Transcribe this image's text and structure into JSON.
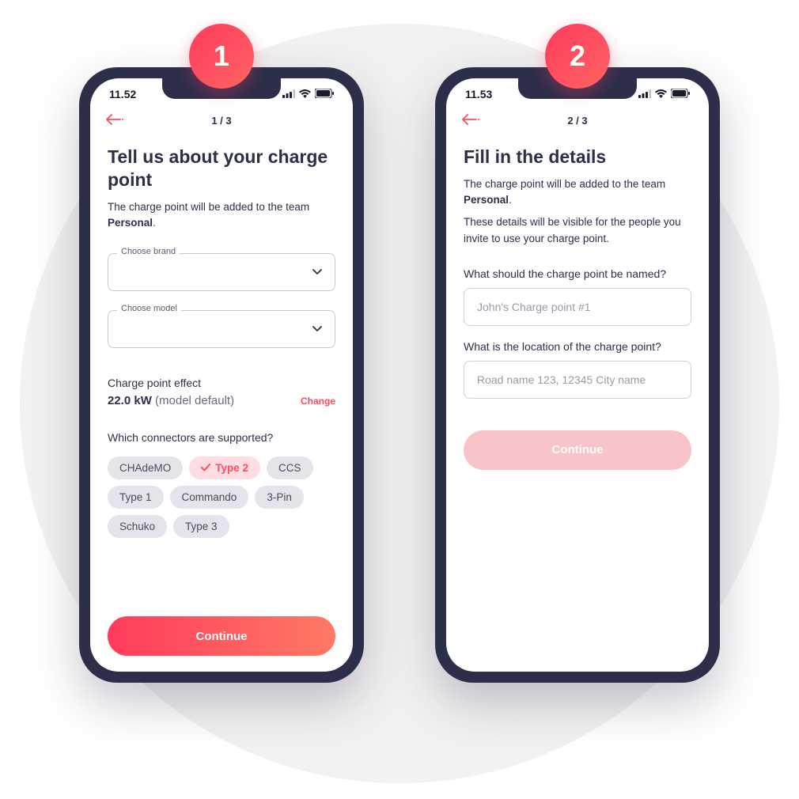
{
  "badges": {
    "one": "1",
    "two": "2"
  },
  "status": {
    "time1": "11.52",
    "time2": "11.53"
  },
  "screen1": {
    "step": "1 / 3",
    "title": "Tell us about your charge point",
    "subtitle_pre": "The charge point will be added to the team ",
    "subtitle_bold": "Personal",
    "subtitle_post": ".",
    "brand_label": "Choose brand",
    "model_label": "Choose model",
    "effect_label": "Charge point effect",
    "effect_value": "22.0 kW",
    "effect_note": " (model default)",
    "change_label": "Change",
    "connectors_label": "Which connectors are supported?",
    "connectors": [
      {
        "label": "CHAdeMO",
        "selected": false
      },
      {
        "label": "Type 2",
        "selected": true
      },
      {
        "label": "CCS",
        "selected": false
      },
      {
        "label": "Type 1",
        "selected": false
      },
      {
        "label": "Commando",
        "selected": false
      },
      {
        "label": "3-Pin",
        "selected": false
      },
      {
        "label": "Schuko",
        "selected": false
      },
      {
        "label": "Type 3",
        "selected": false
      }
    ],
    "continue": "Continue"
  },
  "screen2": {
    "step": "2 / 3",
    "title": "Fill in the details",
    "subtitle_pre": "The charge point will be added to the team ",
    "subtitle_bold": "Personal",
    "subtitle_post": ".",
    "subtitle2": "These details will be visible for the people you invite to use your charge point.",
    "name_label": "What should the charge point be named?",
    "name_placeholder": "John's Charge point #1",
    "location_label": "What is the location of the charge point?",
    "location_placeholder": "Road name 123, 12345 City name",
    "continue": "Continue"
  }
}
